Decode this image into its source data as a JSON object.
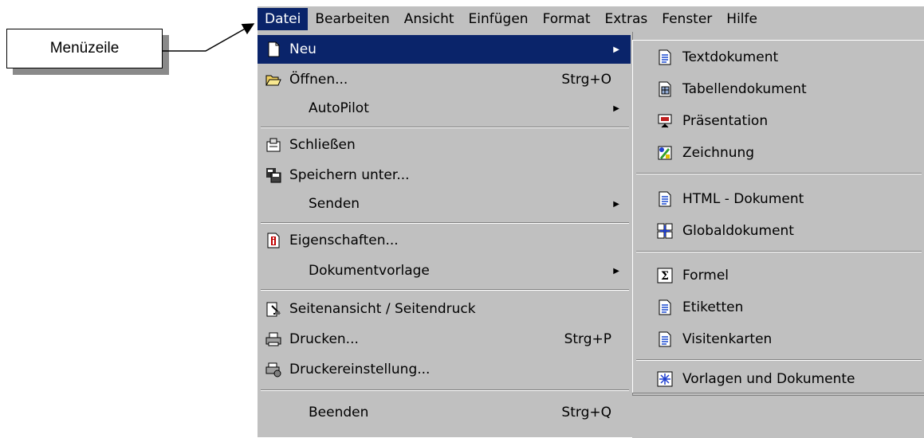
{
  "callout": {
    "label": "Menüzeile"
  },
  "menubar": {
    "items": [
      {
        "label": "Datei"
      },
      {
        "label": "Bearbeiten"
      },
      {
        "label": "Ansicht"
      },
      {
        "label": "Einfügen"
      },
      {
        "label": "Format"
      },
      {
        "label": "Extras"
      },
      {
        "label": "Fenster"
      },
      {
        "label": "Hilfe"
      }
    ]
  },
  "datei_menu": {
    "items": [
      {
        "label": "Neu",
        "shortcut": "",
        "submenu": true,
        "icon": "new-document-icon"
      },
      {
        "label": "Öffnen...",
        "shortcut": "Strg+O",
        "submenu": false,
        "icon": "open-folder-icon"
      },
      {
        "label": "AutoPilot",
        "shortcut": "",
        "submenu": true,
        "icon": ""
      },
      {
        "label": "Schließen",
        "shortcut": "",
        "submenu": false,
        "icon": "close-document-icon"
      },
      {
        "label": "Speichern unter...",
        "shortcut": "",
        "submenu": false,
        "icon": "save-as-icon"
      },
      {
        "label": "Senden",
        "shortcut": "",
        "submenu": true,
        "icon": ""
      },
      {
        "label": "Eigenschaften...",
        "shortcut": "",
        "submenu": false,
        "icon": "properties-icon"
      },
      {
        "label": "Dokumentvorlage",
        "shortcut": "",
        "submenu": true,
        "icon": ""
      },
      {
        "label": "Seitenansicht / Seitendruck",
        "shortcut": "",
        "submenu": false,
        "icon": "page-preview-icon"
      },
      {
        "label": "Drucken...",
        "shortcut": "Strg+P",
        "submenu": false,
        "icon": "printer-icon"
      },
      {
        "label": "Druckereinstellung...",
        "shortcut": "",
        "submenu": false,
        "icon": "printer-settings-icon"
      },
      {
        "label": "Beenden",
        "shortcut": "Strg+Q",
        "submenu": false,
        "icon": ""
      }
    ]
  },
  "neu_submenu": {
    "items": [
      {
        "label": "Textdokument",
        "icon": "text-document-icon"
      },
      {
        "label": "Tabellendokument",
        "icon": "spreadsheet-icon"
      },
      {
        "label": "Präsentation",
        "icon": "presentation-icon"
      },
      {
        "label": "Zeichnung",
        "icon": "drawing-icon"
      },
      {
        "label": "HTML - Dokument",
        "icon": "html-document-icon"
      },
      {
        "label": "Globaldokument",
        "icon": "global-document-icon"
      },
      {
        "label": "Formel",
        "icon": "formula-icon"
      },
      {
        "label": "Etiketten",
        "icon": "labels-icon"
      },
      {
        "label": "Visitenkarten",
        "icon": "business-cards-icon"
      },
      {
        "label": "Vorlagen und Dokumente",
        "icon": "templates-icon"
      }
    ]
  },
  "colors": {
    "highlight": "#0a246a",
    "menu_bg": "#c0c0c0",
    "highlight_text": "#ffffff"
  }
}
